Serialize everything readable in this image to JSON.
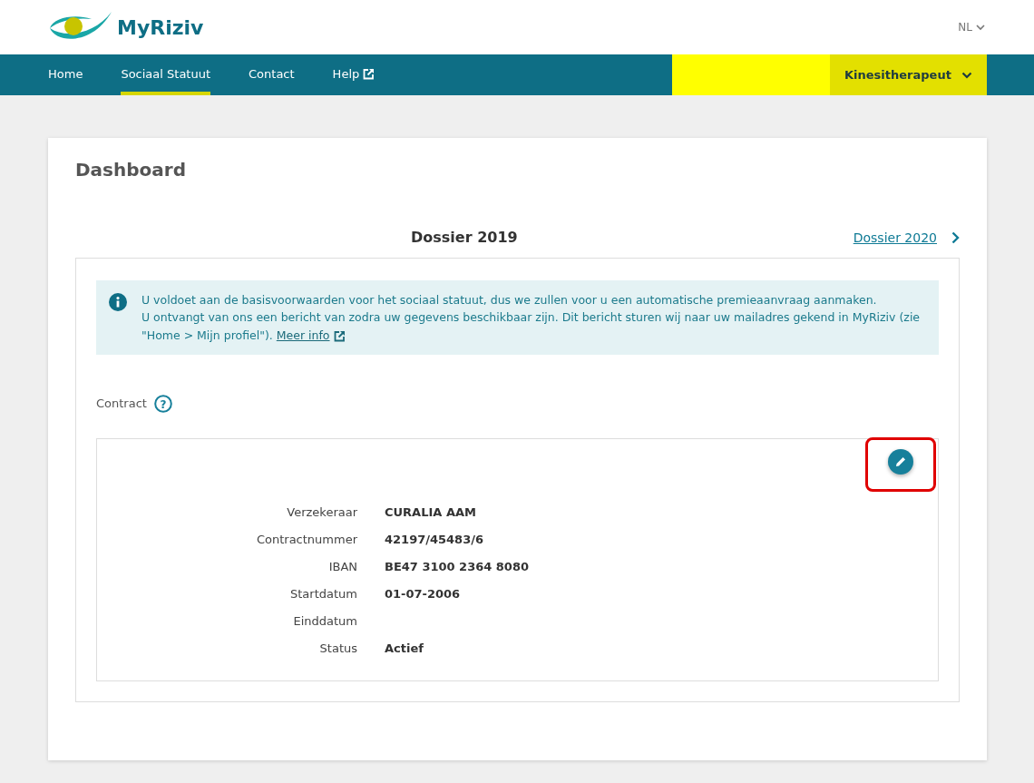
{
  "header": {
    "logo_text": "MyRiziv",
    "language": "NL"
  },
  "nav": {
    "items": [
      {
        "label": "Home",
        "selected": false,
        "external": false
      },
      {
        "label": "Sociaal Statuut",
        "selected": true,
        "external": false
      },
      {
        "label": "Contact",
        "selected": false,
        "external": false
      },
      {
        "label": "Help",
        "selected": false,
        "external": true
      }
    ],
    "redacted_block": true,
    "role_menu": {
      "label": "Kinesitherapeut",
      "highlighted": true
    }
  },
  "dashboard": {
    "title": "Dashboard",
    "dossier_title": "Dossier 2019",
    "next_link": "Dossier 2020",
    "alert": {
      "lines": [
        "U voldoet aan de basisvoorwaarden voor het sociaal statuut, dus we zullen voor u een automatische premieaanvraag aanmaken.",
        "U ontvangt van ons een bericht van zodra uw gegevens beschikbaar zijn. Dit bericht sturen wij naar uw mailadres gekend in MyRiziv (zie \"Home > Mijn profiel\")."
      ],
      "link": "Meer info"
    },
    "contract": {
      "heading": "Contract",
      "help_symbol": "?",
      "edit_highlighted": true,
      "fields": [
        {
          "label": "Verzekeraar",
          "value": "CURALIA AAM"
        },
        {
          "label": "Contractnummer",
          "value": "42197/45483/6"
        },
        {
          "label": "IBAN",
          "value": "BE47 3100 2364 8080"
        },
        {
          "label": "Startdatum",
          "value": "01-07-2006"
        },
        {
          "label": "Einddatum"
        },
        {
          "label": "Status",
          "value": "Actief"
        }
      ]
    }
  }
}
